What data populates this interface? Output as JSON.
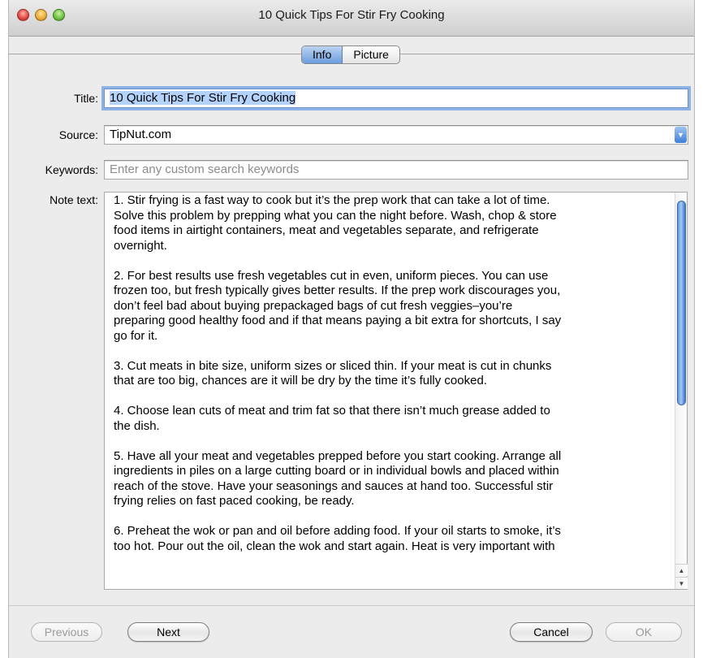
{
  "window": {
    "title": "10 Quick Tips For Stir Fry Cooking"
  },
  "tabs": [
    {
      "label": "Info",
      "active": true
    },
    {
      "label": "Picture",
      "active": false
    }
  ],
  "form": {
    "title_label": "Title:",
    "title_value": "10 Quick Tips For Stir Fry Cooking",
    "source_label": "Source:",
    "source_value": "TipNut.com",
    "keywords_label": "Keywords:",
    "keywords_placeholder": "Enter any custom search keywords",
    "note_label": "Note text:"
  },
  "notes": [
    "1. Stir frying is a fast way to cook but it’s the prep work that can take a lot of time.\nSolve this problem by prepping what you can the night before. Wash, chop & store\nfood items in airtight containers, meat and vegetables separate, and refrigerate\novernight.",
    "2. For best results use fresh vegetables cut in even, uniform pieces. You can use\nfrozen too, but fresh typically gives better results. If the prep work discourages you,\ndon’t feel bad about buying prepackaged bags of cut fresh veggies–you’re\npreparing good healthy food and if that means paying a bit extra for shortcuts, I say\ngo for it.",
    "3. Cut meats in bite size, uniform sizes or sliced thin. If your meat is cut in chunks\nthat are too big, chances are it will be dry by the time it’s fully cooked.",
    "4. Choose lean cuts of meat and trim fat so that there isn’t much grease added to\nthe dish.",
    "5. Have all your meat and vegetables prepped before you start cooking. Arrange all\ningredients in piles on a large cutting board or in individual bowls and placed within\nreach of the stove. Have your seasonings and sauces at hand too. Successful stir\nfrying relies on fast paced cooking, be ready.",
    "6. Preheat the wok or pan and oil before adding food. If your oil starts to smoke, it’s\ntoo hot. Pour out the oil, clean the wok and start again. Heat is very important with"
  ],
  "buttons": {
    "previous": "Previous",
    "next": "Next",
    "cancel": "Cancel",
    "ok": "OK"
  },
  "icons": {
    "close": "close-icon",
    "minimize": "minimize-icon",
    "zoom": "zoom-icon",
    "dropdown": "chevron-down-icon",
    "scroll_up": "arrow-up-icon",
    "scroll_down": "arrow-down-icon"
  },
  "colors": {
    "selection": "#b3d3fd",
    "focus_ring": "#8fb2e6",
    "accent": "#3f7fd6"
  }
}
